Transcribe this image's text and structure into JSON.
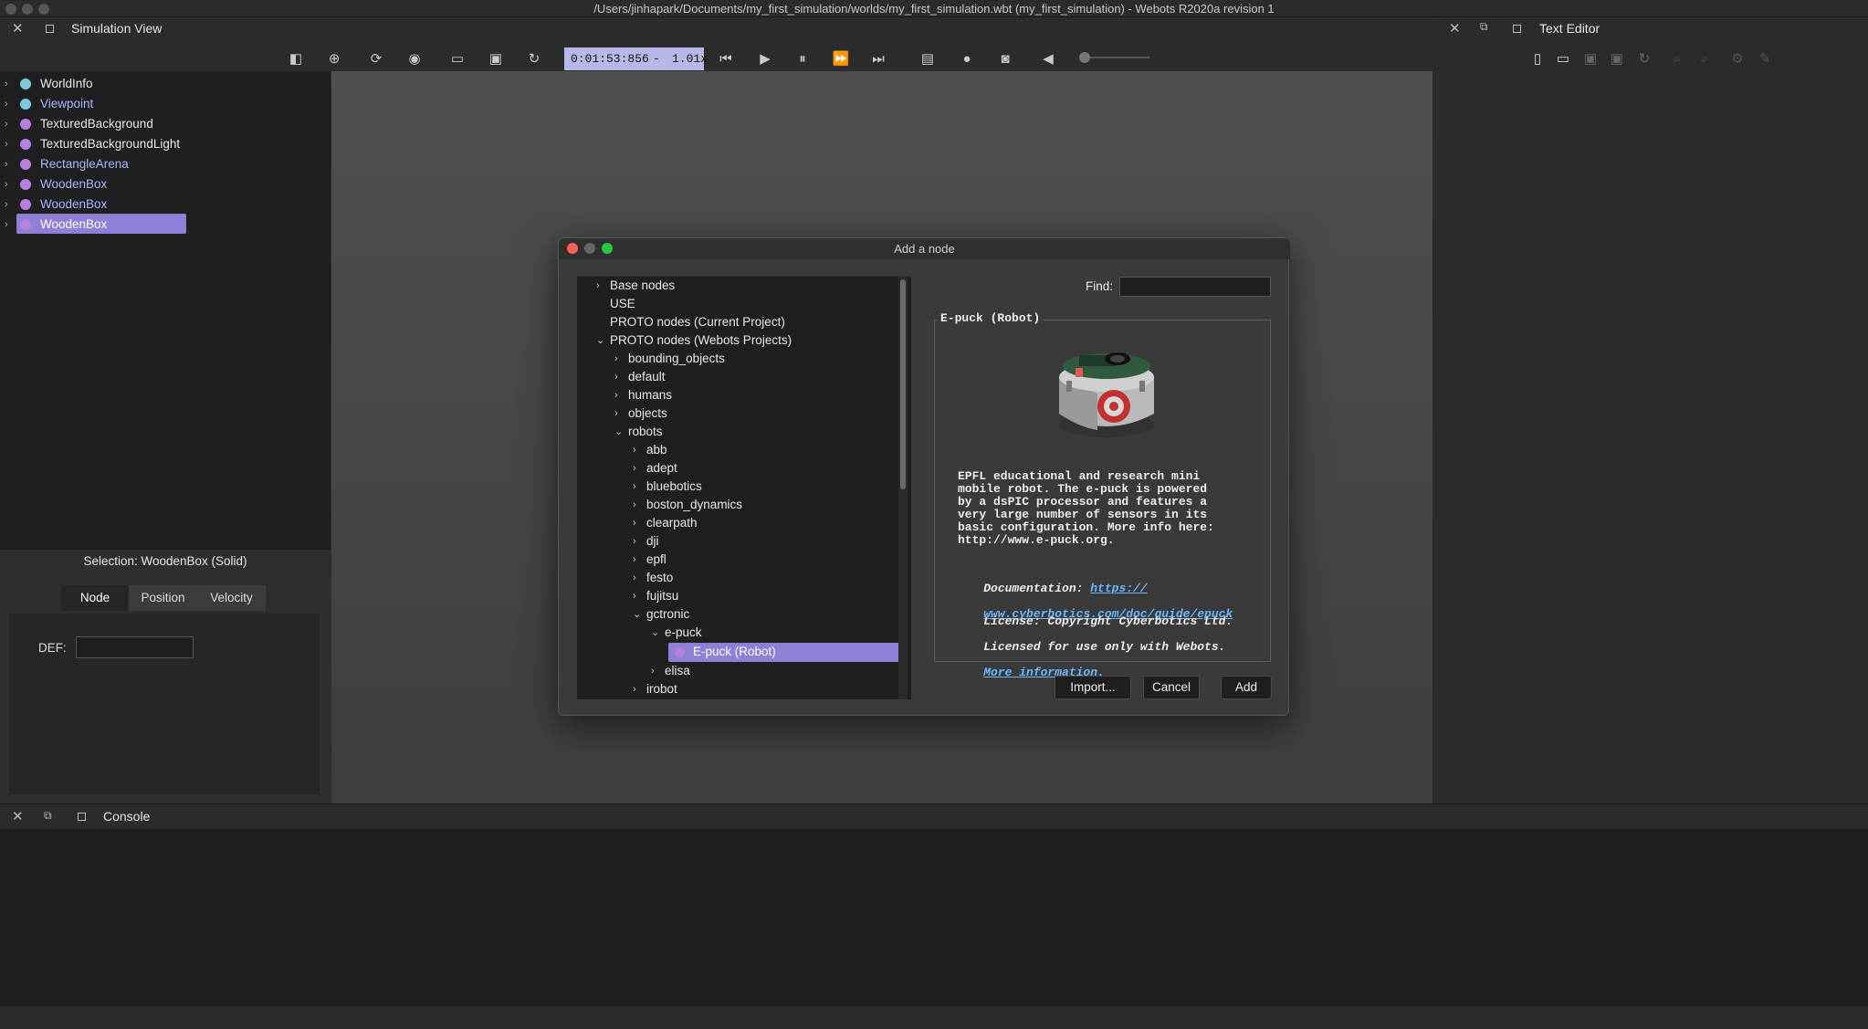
{
  "app": {
    "window_title": "/Users/jinhapark/Documents/my_first_simulation/worlds/my_first_simulation.wbt (my_first_simulation) - Webots R2020a revision 1"
  },
  "panels": {
    "simulation_view": "Simulation View",
    "text_editor": "Text Editor",
    "console": "Console"
  },
  "toolbar": {
    "time": "0:01:53:856",
    "separator": "-",
    "speed": "1.01x"
  },
  "scene_tree": {
    "items": [
      {
        "label": "WorldInfo",
        "color": "#7ec8e3"
      },
      {
        "label": "Viewpoint",
        "color": "#7ec8e3"
      },
      {
        "label": "TexturedBackground",
        "color": "#b77fe0"
      },
      {
        "label": "TexturedBackgroundLight",
        "color": "#b77fe0"
      },
      {
        "label": "RectangleArena",
        "color": "#b77fe0"
      },
      {
        "label": "WoodenBox",
        "color": "#b77fe0"
      },
      {
        "label": "WoodenBox",
        "color": "#b77fe0"
      },
      {
        "label": "WoodenBox",
        "color": "#b77fe0"
      }
    ]
  },
  "selection": {
    "title": "Selection: WoodenBox (Solid)",
    "tabs": [
      "Node",
      "Position",
      "Velocity"
    ],
    "def_label": "DEF:",
    "def_value": ""
  },
  "dialog": {
    "title": "Add a node",
    "tree": {
      "base_nodes": "Base nodes",
      "use": "USE",
      "proto_current": "PROTO nodes (Current Project)",
      "proto_webots": "PROTO nodes (Webots Projects)",
      "bounding_objects": "bounding_objects",
      "default": "default",
      "humans": "humans",
      "objects": "objects",
      "robots": "robots",
      "abb": "abb",
      "adept": "adept",
      "bluebotics": "bluebotics",
      "boston_dynamics": "boston_dynamics",
      "clearpath": "clearpath",
      "dji": "dji",
      "epfl": "epfl",
      "festo": "festo",
      "fujitsu": "fujitsu",
      "gctronic": "gctronic",
      "e_puck": "e-puck",
      "e_puck_robot": "E-puck (Robot)",
      "elisa": "elisa",
      "irobot": "irobot"
    },
    "find_label": "Find:",
    "find_value": "",
    "info_title": "E-puck (Robot)",
    "description": "EPFL educational and research mini\nmobile robot. The e-puck is powered\nby a dsPIC processor and features a\nvery large number of sensors in its\nbasic configuration. More info here:\nhttp://www.e-puck.org.",
    "doc_label": "Documentation:",
    "doc_link_1": "https://",
    "doc_link_2": "www.cyberbotics.com/doc/guide/epuck",
    "license_1": "License: Copyright Cyberbotics Ltd.",
    "license_2": "Licensed for use only with Webots.",
    "more_info": "More information.",
    "buttons": {
      "import": "Import...",
      "cancel": "Cancel",
      "add": "Add"
    }
  },
  "colors": {
    "accent": "#b7b8e8",
    "selection": "#8f7fd6"
  }
}
